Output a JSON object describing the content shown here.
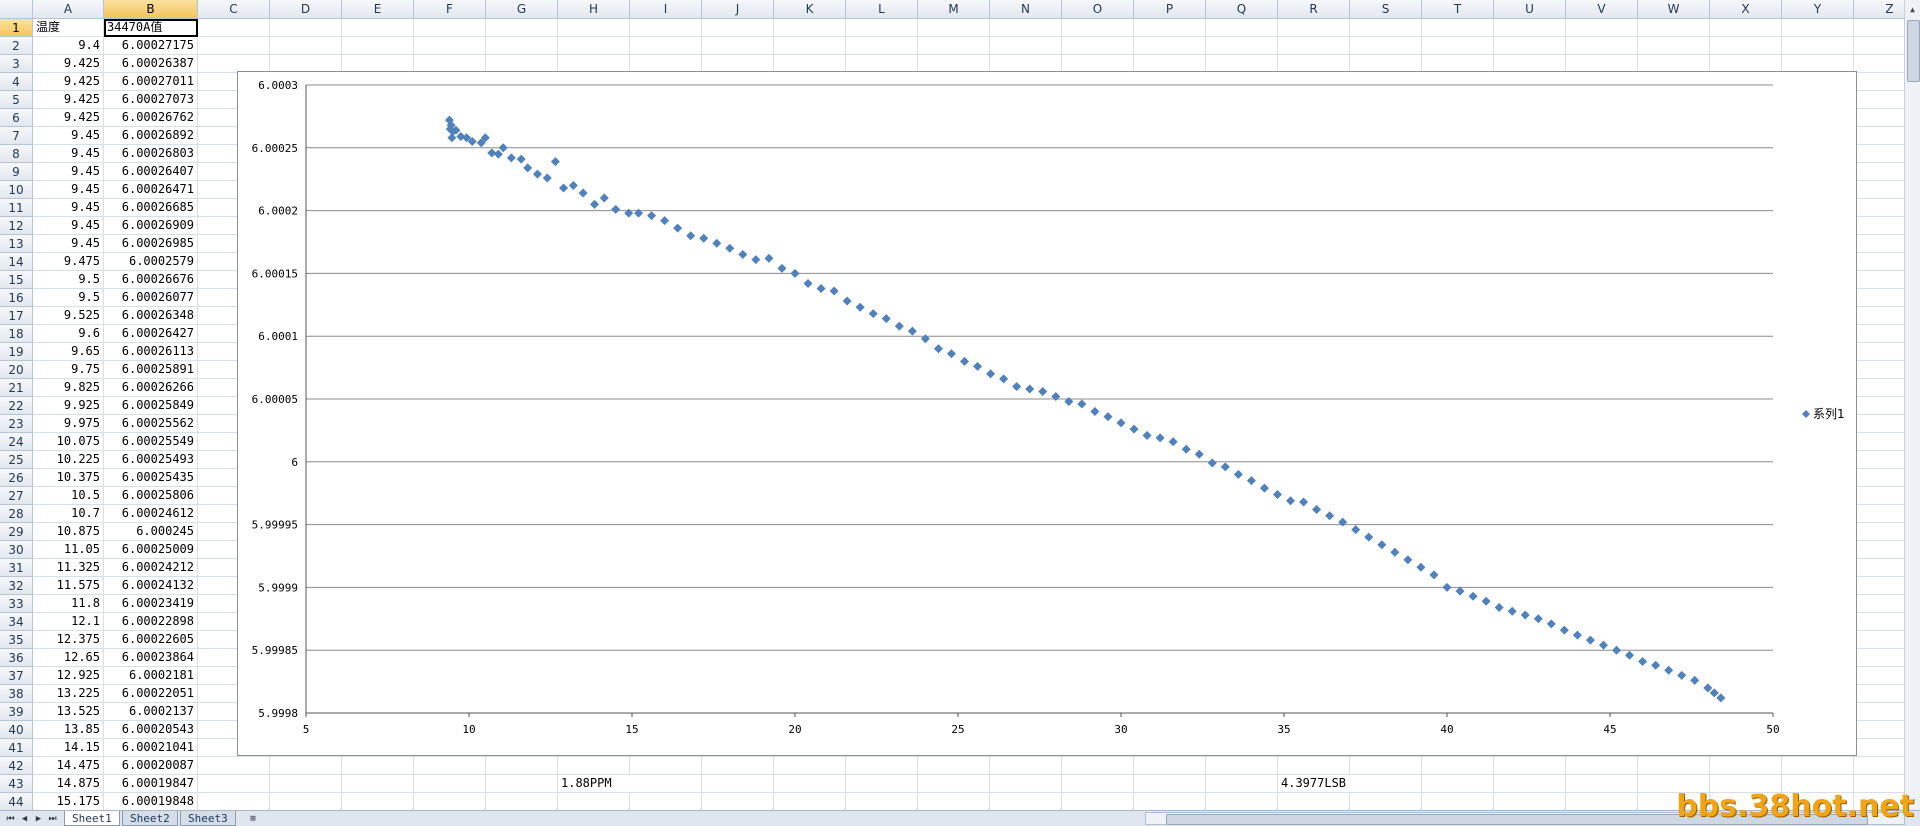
{
  "colors": {
    "marker": "#4f81bd",
    "grid": "#8c8c8c",
    "header_bg": "#e2e8f0",
    "header_selected": "#f3c55a",
    "watermark": "#f0a418"
  },
  "columns": [
    "A",
    "B",
    "C",
    "D",
    "E",
    "F",
    "G",
    "H",
    "I",
    "J",
    "K",
    "L",
    "M",
    "N",
    "O",
    "P",
    "Q",
    "R",
    "S",
    "T",
    "U",
    "V",
    "W",
    "X",
    "Y",
    "Z"
  ],
  "selected_column": "B",
  "selected_row": 1,
  "header_row": {
    "a": "温度",
    "b": "34470A值"
  },
  "rows": [
    [
      "9.4",
      "6.00027175"
    ],
    [
      "9.425",
      "6.00026387"
    ],
    [
      "9.425",
      "6.00027011"
    ],
    [
      "9.425",
      "6.00027073"
    ],
    [
      "9.425",
      "6.00026762"
    ],
    [
      "9.45",
      "6.00026892"
    ],
    [
      "9.45",
      "6.00026803"
    ],
    [
      "9.45",
      "6.00026407"
    ],
    [
      "9.45",
      "6.00026471"
    ],
    [
      "9.45",
      "6.00026685"
    ],
    [
      "9.45",
      "6.00026909"
    ],
    [
      "9.45",
      "6.00026985"
    ],
    [
      "9.475",
      "6.0002579"
    ],
    [
      "9.5",
      "6.00026676"
    ],
    [
      "9.5",
      "6.00026077"
    ],
    [
      "9.525",
      "6.00026348"
    ],
    [
      "9.6",
      "6.00026427"
    ],
    [
      "9.65",
      "6.00026113"
    ],
    [
      "9.75",
      "6.00025891"
    ],
    [
      "9.825",
      "6.00026266"
    ],
    [
      "9.925",
      "6.00025849"
    ],
    [
      "9.975",
      "6.00025562"
    ],
    [
      "10.075",
      "6.00025549"
    ],
    [
      "10.225",
      "6.00025493"
    ],
    [
      "10.375",
      "6.00025435"
    ],
    [
      "10.5",
      "6.00025806"
    ],
    [
      "10.7",
      "6.00024612"
    ],
    [
      "10.875",
      "6.000245"
    ],
    [
      "11.05",
      "6.00025009"
    ],
    [
      "11.325",
      "6.00024212"
    ],
    [
      "11.575",
      "6.00024132"
    ],
    [
      "11.8",
      "6.00023419"
    ],
    [
      "12.1",
      "6.00022898"
    ],
    [
      "12.375",
      "6.00022605"
    ],
    [
      "12.65",
      "6.00023864"
    ],
    [
      "12.925",
      "6.0002181"
    ],
    [
      "13.225",
      "6.00022051"
    ],
    [
      "13.525",
      "6.0002137"
    ],
    [
      "13.85",
      "6.00020543"
    ],
    [
      "14.15",
      "6.00021041"
    ],
    [
      "14.475",
      "6.00020087"
    ],
    [
      "14.875",
      "6.00019847"
    ],
    [
      "15.175",
      "6.00019848"
    ]
  ],
  "notes": {
    "left": "1.88PPM",
    "right": "4.3977LSB"
  },
  "sheet_tabs": [
    "Sheet1",
    "Sheet2",
    "Sheet3"
  ],
  "active_tab": "Sheet1",
  "icons": {
    "nav_first": "first-sheet-icon",
    "nav_prev": "prev-sheet-icon",
    "nav_next": "next-sheet-icon",
    "nav_last": "last-sheet-icon",
    "insert_sheet": "insert-sheet-icon"
  },
  "watermark": "bbs.38hot.net",
  "chart_data": {
    "type": "scatter",
    "title": "",
    "xlabel": "",
    "ylabel": "",
    "xlim": [
      5,
      50
    ],
    "ylim": [
      5.9998,
      6.0003
    ],
    "xticks": [
      "5",
      "10",
      "15",
      "20",
      "25",
      "30",
      "35",
      "40",
      "45",
      "50"
    ],
    "yticks": [
      "6.0003",
      "6.00025",
      "6.0002",
      "6.00015",
      "6.0001",
      "6.00005",
      "6",
      "5.99995",
      "5.9999",
      "5.99985",
      "5.9998"
    ],
    "grid": "horizontal",
    "legend_position": "right",
    "series": [
      {
        "name": "系列1",
        "marker": "diamond",
        "x": [
          9.4,
          9.425,
          9.45,
          9.475,
          9.5,
          9.6,
          9.75,
          9.925,
          10.1,
          10.375,
          10.5,
          10.7,
          10.9,
          11.05,
          11.3,
          11.6,
          11.8,
          12.1,
          12.4,
          12.65,
          12.9,
          13.2,
          13.5,
          13.85,
          14.15,
          14.5,
          14.9,
          15.2,
          15.6,
          16,
          16.4,
          16.8,
          17.2,
          17.6,
          18,
          18.4,
          18.8,
          19.2,
          19.6,
          20,
          20.4,
          20.8,
          21.2,
          21.6,
          22,
          22.4,
          22.8,
          23.2,
          23.6,
          24,
          24.4,
          24.8,
          25.2,
          25.6,
          26,
          26.4,
          26.8,
          27.2,
          27.6,
          28,
          28.4,
          28.8,
          29.2,
          29.6,
          30,
          30.4,
          30.8,
          31.2,
          31.6,
          32,
          32.4,
          32.8,
          33.2,
          33.6,
          34,
          34.4,
          34.8,
          35.2,
          35.6,
          36,
          36.4,
          36.8,
          37.2,
          37.6,
          38,
          38.4,
          38.8,
          39.2,
          39.6,
          40,
          40.4,
          40.8,
          41.2,
          41.6,
          42,
          42.4,
          42.8,
          43.2,
          43.6,
          44,
          44.4,
          44.8,
          45.2,
          45.6,
          46,
          46.4,
          46.8,
          47.2,
          47.6,
          48,
          48.2,
          48.4
        ],
        "y": [
          6.000272,
          6.000265,
          6.000268,
          6.000258,
          6.000263,
          6.000264,
          6.000259,
          6.000258,
          6.000255,
          6.000254,
          6.000258,
          6.000246,
          6.000245,
          6.00025,
          6.000242,
          6.000241,
          6.000234,
          6.000229,
          6.000226,
          6.000239,
          6.000218,
          6.00022,
          6.000214,
          6.000205,
          6.00021,
          6.000201,
          6.000198,
          6.000198,
          6.000196,
          6.000192,
          6.000186,
          6.00018,
          6.000178,
          6.000174,
          6.00017,
          6.000165,
          6.000161,
          6.000162,
          6.000154,
          6.00015,
          6.000142,
          6.000138,
          6.000136,
          6.000128,
          6.000123,
          6.000118,
          6.000114,
          6.000108,
          6.000104,
          6.000098,
          6.00009,
          6.000086,
          6.00008,
          6.000076,
          6.00007,
          6.000066,
          6.00006,
          6.000058,
          6.000056,
          6.000052,
          6.000048,
          6.000046,
          6.00004,
          6.000036,
          6.000031,
          6.000026,
          6.000021,
          6.000019,
          6.000016,
          6.00001,
          6.000006,
          5.999999,
          5.999996,
          5.99999,
          5.999985,
          5.999979,
          5.999974,
          5.999969,
          5.999968,
          5.999962,
          5.999957,
          5.999952,
          5.999946,
          5.99994,
          5.999934,
          5.999928,
          5.999922,
          5.999916,
          5.99991,
          5.9999,
          5.999897,
          5.999893,
          5.999889,
          5.999884,
          5.999881,
          5.999878,
          5.999875,
          5.999871,
          5.999866,
          5.999862,
          5.999858,
          5.999854,
          5.99985,
          5.999846,
          5.999841,
          5.999838,
          5.999834,
          5.99983,
          5.999826,
          5.99982,
          5.999816,
          5.999812
        ]
      }
    ]
  }
}
